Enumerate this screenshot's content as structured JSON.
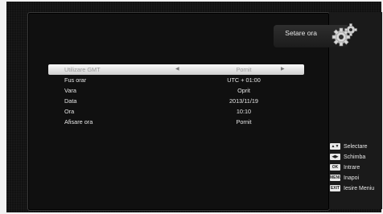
{
  "header": {
    "title": "Setare ora",
    "icon": "gears-icon"
  },
  "menu": {
    "items": [
      {
        "label": "Utilizare GMT",
        "value": "Pornit",
        "selected": true
      },
      {
        "label": "Fus orar",
        "value": "UTC + 01:00"
      },
      {
        "label": "Vara",
        "value": "Oprit"
      },
      {
        "label": "Data",
        "value": "2013/11/19"
      },
      {
        "label": "Ora",
        "value": "10:10"
      },
      {
        "label": "Afisare ora",
        "value": "Pornit"
      }
    ]
  },
  "legend": {
    "items": [
      {
        "key": "▲▼",
        "icon": "up-down-key-icon",
        "label": "Selectare"
      },
      {
        "key": "◀▶",
        "icon": "left-right-key-icon",
        "label": "Schimba"
      },
      {
        "key": "OK",
        "icon": "ok-key-icon",
        "label": "Intrare"
      },
      {
        "key": "MENU",
        "icon": "menu-key-icon",
        "label": "Inapoi"
      },
      {
        "key": "EXIT",
        "icon": "exit-key-icon",
        "label": "Iesire Meniu"
      }
    ]
  }
}
